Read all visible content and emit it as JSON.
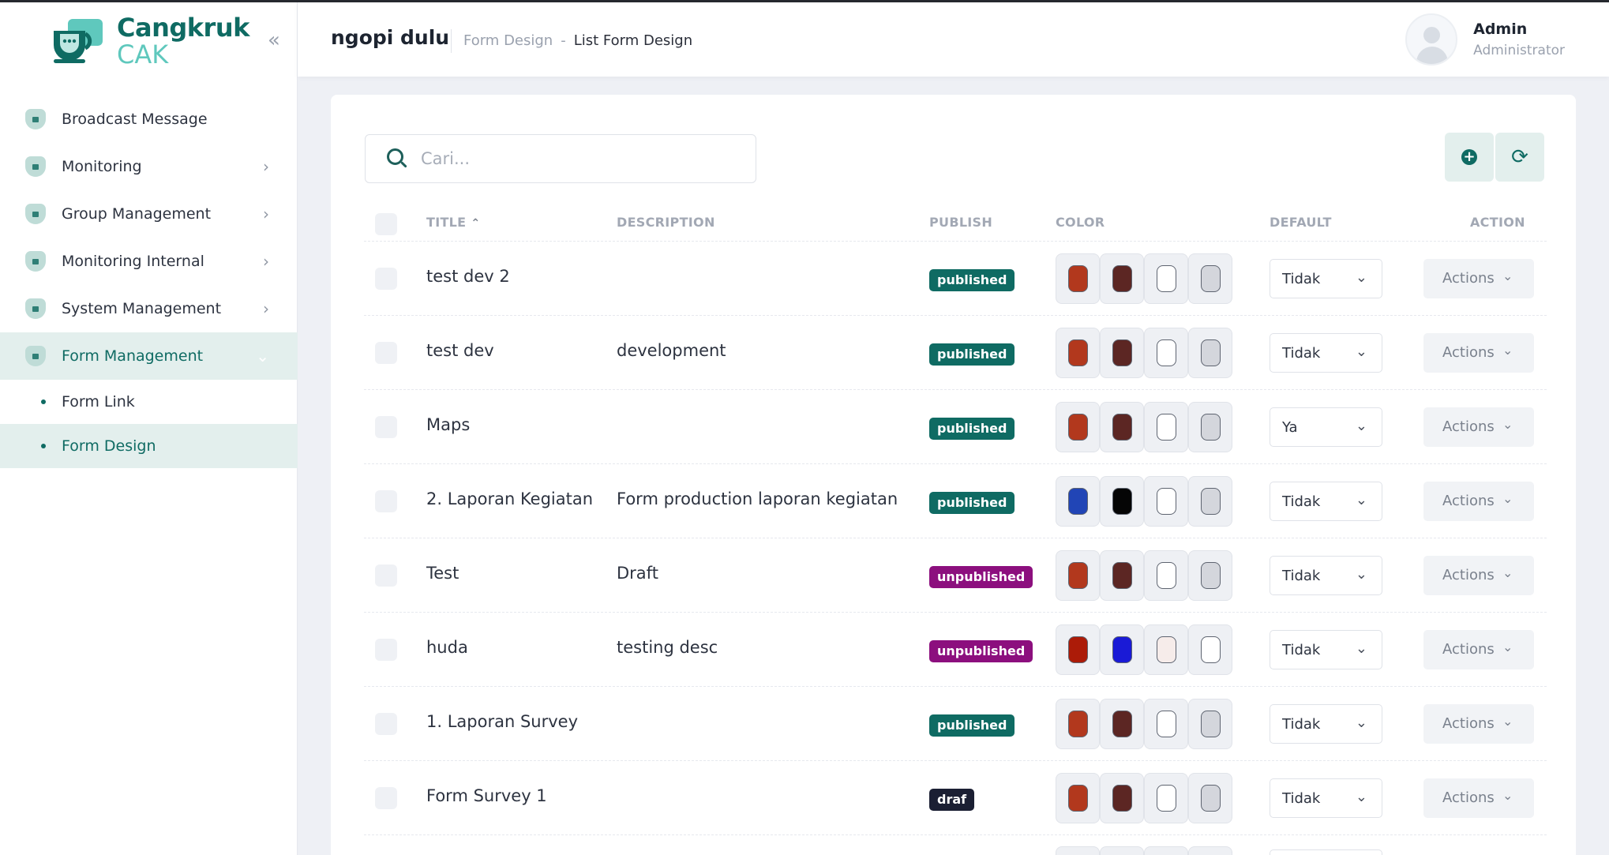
{
  "sidebar": {
    "brand_name": "Cangkruk",
    "brand_sub": "CAK",
    "collapse_glyph": "«",
    "items": [
      {
        "label": "Broadcast Message",
        "has_chevron": false
      },
      {
        "label": "Monitoring",
        "has_chevron": true
      },
      {
        "label": "Group Management",
        "has_chevron": true
      },
      {
        "label": "Monitoring Internal",
        "has_chevron": true
      },
      {
        "label": "System Management",
        "has_chevron": true
      },
      {
        "label": "Form Management",
        "has_chevron": true,
        "active": true
      }
    ],
    "subitems": [
      {
        "label": "Form Link",
        "active": false
      },
      {
        "label": "Form Design",
        "active": true
      }
    ]
  },
  "header": {
    "title": "ngopi dulu",
    "breadcrumb_link": "Form Design",
    "breadcrumb_sep": "-",
    "breadcrumb_current": "List Form Design",
    "user_name": "Admin",
    "user_role": "Administrator"
  },
  "search": {
    "placeholder": "Cari..."
  },
  "table": {
    "columns": {
      "title": "TITLE",
      "description": "DESCRIPTION",
      "publish": "PUBLISH",
      "color": "COLOR",
      "default": "DEFAULT",
      "action": "ACTION"
    },
    "actions_label": "Actions",
    "rows": [
      {
        "title": "test dev 2",
        "description": "",
        "status": "published",
        "colors": [
          "#b2381d",
          "#5c2623",
          "#ffffff",
          "#d4d6dc"
        ],
        "default": "Tidak"
      },
      {
        "title": "test dev",
        "description": "development",
        "status": "published",
        "colors": [
          "#b2381d",
          "#5c2623",
          "#ffffff",
          "#d4d6dc"
        ],
        "default": "Tidak"
      },
      {
        "title": "Maps",
        "description": "",
        "status": "published",
        "colors": [
          "#b2381d",
          "#5c2623",
          "#ffffff",
          "#d4d6dc"
        ],
        "default": "Ya"
      },
      {
        "title": "2. Laporan Kegiatan",
        "description": "Form production laporan kegiatan",
        "status": "published",
        "colors": [
          "#2145b6",
          "#050505",
          "#ffffff",
          "#d4d6dc"
        ],
        "default": "Tidak"
      },
      {
        "title": "Test",
        "description": "Draft",
        "status": "unpublished",
        "colors": [
          "#b2381d",
          "#5c2623",
          "#ffffff",
          "#d4d6dc"
        ],
        "default": "Tidak"
      },
      {
        "title": "huda",
        "description": "testing desc",
        "status": "unpublished",
        "colors": [
          "#ac1b08",
          "#1a1ad6",
          "#f6ecea",
          "#ffffff"
        ],
        "default": "Tidak"
      },
      {
        "title": "1. Laporan Survey",
        "description": "",
        "status": "published",
        "colors": [
          "#b2381d",
          "#5c2623",
          "#ffffff",
          "#d4d6dc"
        ],
        "default": "Tidak"
      },
      {
        "title": "Form Survey 1",
        "description": "",
        "status": "draf",
        "colors": [
          "#b2381d",
          "#5c2623",
          "#ffffff",
          "#d4d6dc"
        ],
        "default": "Tidak"
      }
    ]
  },
  "colors": {
    "primary": "#0f6b63",
    "published": "#0f6b63",
    "unpublished": "#8c0f7e",
    "draf": "#1b1f33"
  }
}
